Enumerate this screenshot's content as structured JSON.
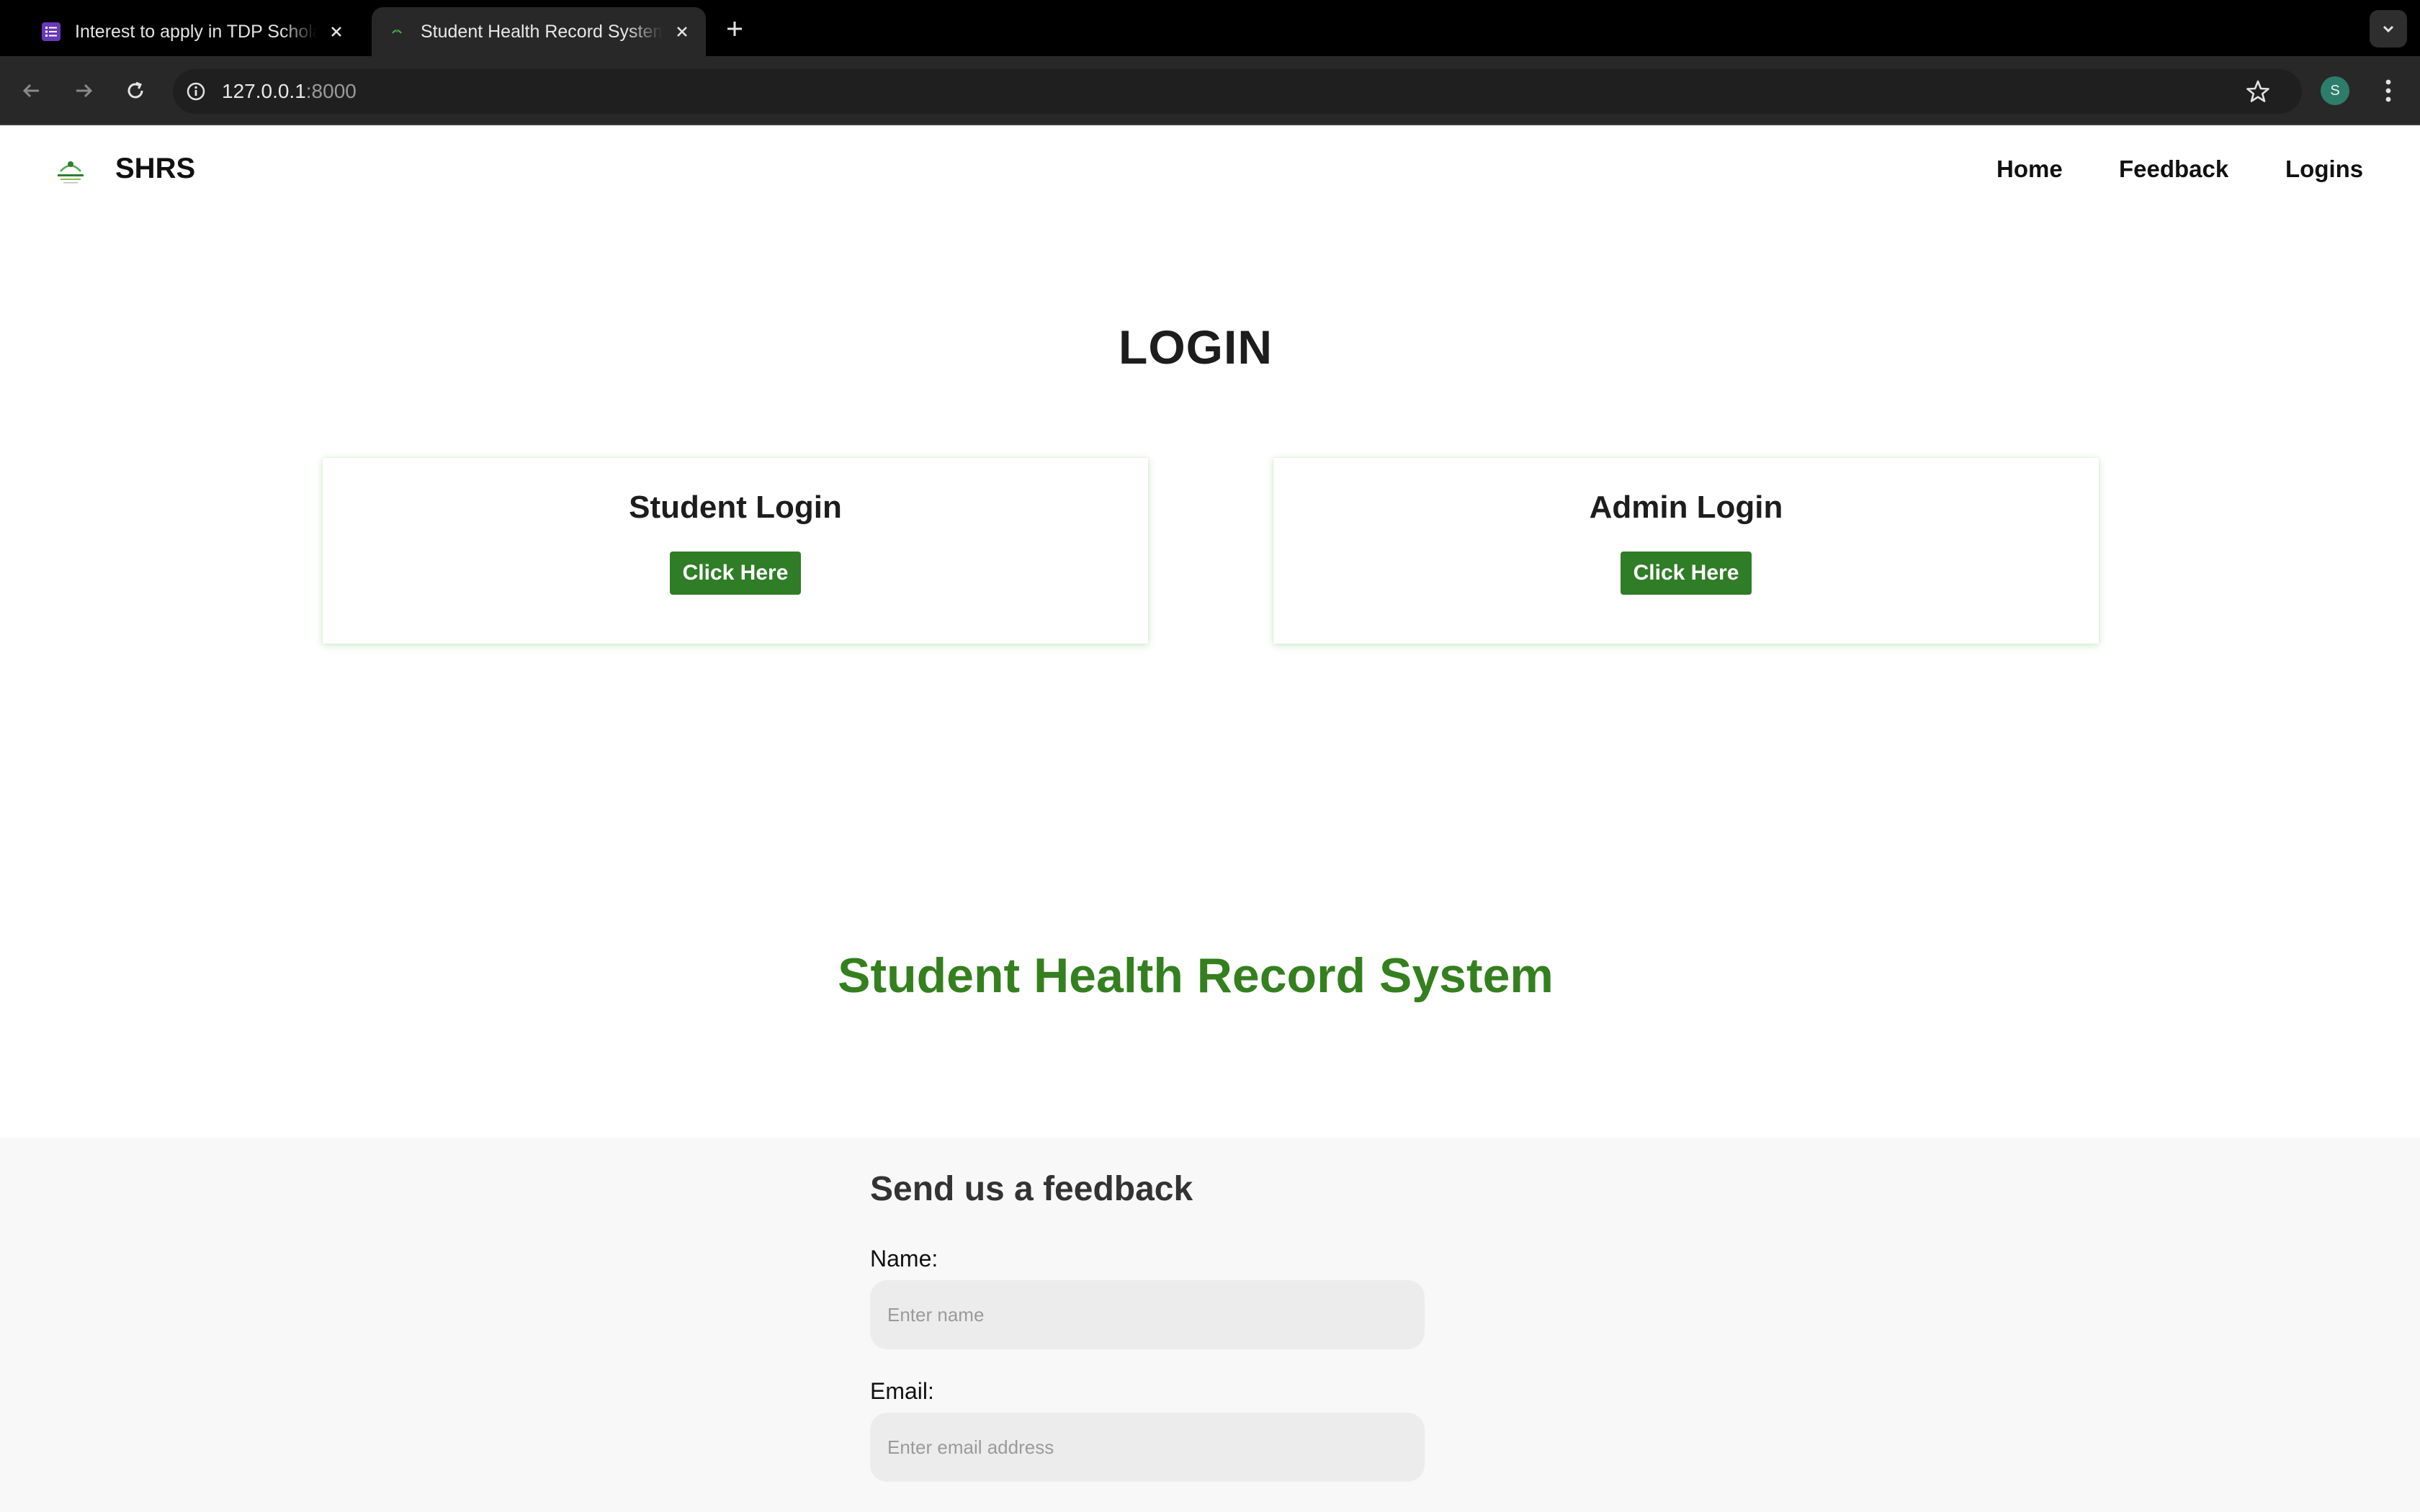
{
  "browser": {
    "tabs": [
      {
        "title": "Interest to apply in TDP Scholarship",
        "active": false
      },
      {
        "title": "Student Health Record System",
        "active": true
      }
    ],
    "url_host": "127.0.0.1",
    "url_port": ":8000",
    "profile_initial": "S"
  },
  "header": {
    "brand": "SHRS",
    "nav": {
      "home": "Home",
      "feedback": "Feedback",
      "logins": "Logins"
    }
  },
  "login": {
    "heading": "LOGIN",
    "cards": [
      {
        "title": "Student Login",
        "button": "Click Here"
      },
      {
        "title": "Admin Login",
        "button": "Click Here"
      }
    ]
  },
  "tagline": "Student Health Record System",
  "feedback": {
    "title": "Send us a feedback",
    "name_label": "Name:",
    "name_placeholder": "Enter name",
    "email_label": "Email:",
    "email_placeholder": "Enter email address"
  },
  "colors": {
    "accent_green": "#34801f",
    "button_green": "#2f7d26"
  }
}
